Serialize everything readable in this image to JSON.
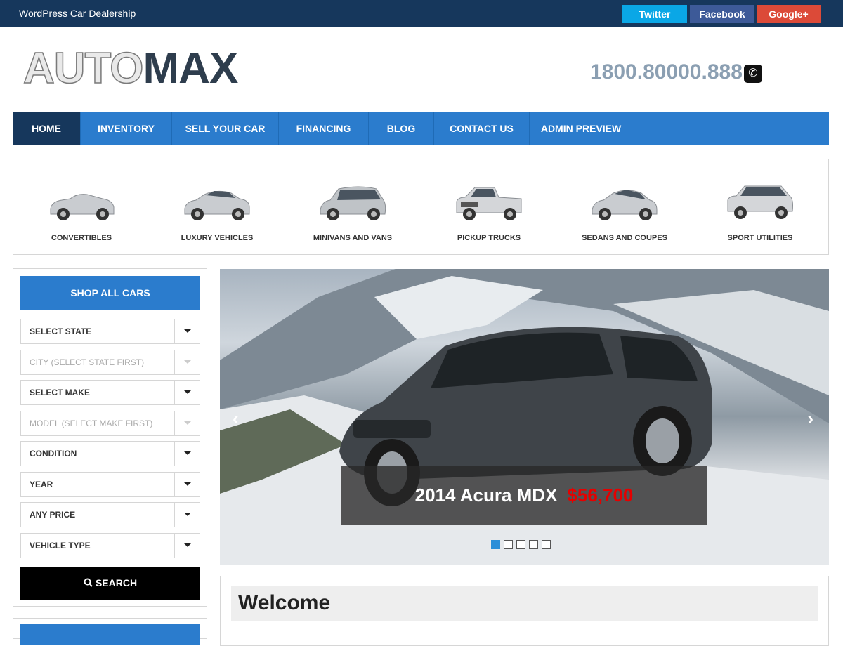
{
  "topbar": {
    "tagline": "WordPress Car Dealership",
    "social": [
      {
        "label": "Twitter",
        "color": "#0aa7e6"
      },
      {
        "label": "Facebook",
        "color": "#3d5a98"
      },
      {
        "label": "Google+",
        "color": "#dc4a38"
      }
    ]
  },
  "header": {
    "logo_part1": "AUTO",
    "logo_part2": "MAX",
    "phone": "1800.80000.888",
    "phone_icon": "phone-icon"
  },
  "nav": {
    "items": [
      {
        "label": "HOME",
        "active": true
      },
      {
        "label": "INVENTORY",
        "active": false
      },
      {
        "label": "SELL YOUR CAR",
        "active": false
      },
      {
        "label": "FINANCING",
        "active": false
      },
      {
        "label": "BLOG",
        "active": false
      },
      {
        "label": "CONTACT US",
        "active": false
      },
      {
        "label": "ADMIN PREVIEW",
        "active": false
      }
    ]
  },
  "categories": [
    {
      "label": "CONVERTIBLES",
      "icon": "convertible-car-icon"
    },
    {
      "label": "LUXURY VEHICLES",
      "icon": "luxury-car-icon"
    },
    {
      "label": "MINIVANS AND VANS",
      "icon": "minivan-icon"
    },
    {
      "label": "PICKUP TRUCKS",
      "icon": "pickup-truck-icon"
    },
    {
      "label": "SEDANS AND COUPES",
      "icon": "sedan-icon"
    },
    {
      "label": "SPORT UTILITIES",
      "icon": "suv-icon"
    }
  ],
  "sidebar": {
    "shop_all": "SHOP ALL CARS",
    "selects": [
      {
        "value": "SELECT STATE",
        "disabled": false
      },
      {
        "value": "CITY (SELECT STATE FIRST)",
        "disabled": true
      },
      {
        "value": "SELECT MAKE",
        "disabled": false
      },
      {
        "value": "MODEL (SELECT MAKE FIRST)",
        "disabled": true
      },
      {
        "value": "CONDITION",
        "disabled": false
      },
      {
        "value": "YEAR",
        "disabled": false
      },
      {
        "value": "ANY PRICE",
        "disabled": false
      },
      {
        "value": "VEHICLE TYPE",
        "disabled": false
      }
    ],
    "search": "SEARCH"
  },
  "slider": {
    "caption_name": "2014 Acura MDX",
    "caption_price": "$56,700",
    "prev": "‹",
    "next": "›",
    "slide_count": 5,
    "active_slide": 1
  },
  "welcome": {
    "title": "Welcome"
  },
  "colors": {
    "accent": "#2b7ccd",
    "dark": "#16375c",
    "price": "#e50000"
  }
}
